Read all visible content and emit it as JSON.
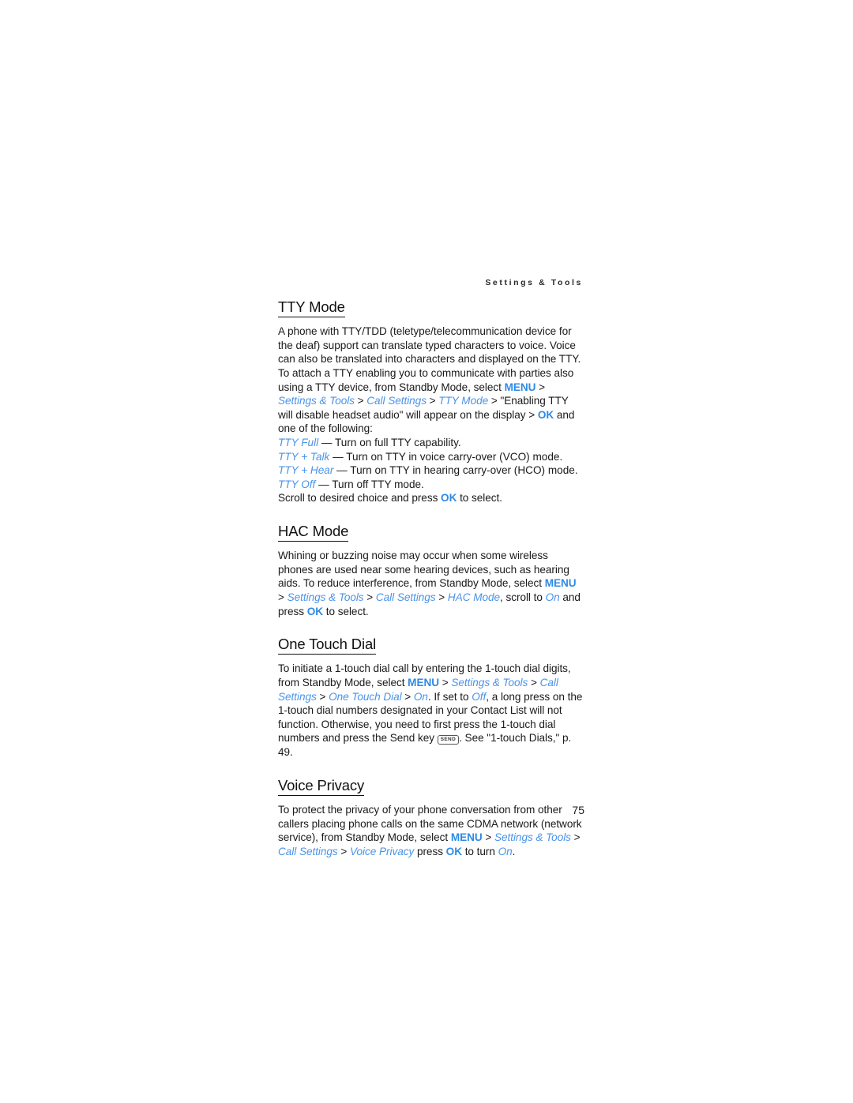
{
  "page": {
    "running_header": "Settings & Tools",
    "page_number": "75",
    "accent_blue": "#4a93e8",
    "accent_blue_bold": "#2e8ae6",
    "text_color": "#1a1a1a",
    "background": "#ffffff"
  },
  "sections": [
    {
      "id": "tty-mode",
      "heading": "TTY Mode",
      "paragraph_1": {
        "t1": "A phone with TTY/TDD (teletype/telecommunication device for the deaf) support can translate typed characters to voice. Voice can also be translated into characters and displayed on the TTY. To attach a TTY enabling you to communicate with parties also using a TTY device, from Standby Mode, select ",
        "menu": "MENU",
        "s1": " > ",
        "nav1": "Settings & Tools",
        "s2": " > ",
        "nav2": "Call Settings",
        "s3": " > ",
        "nav3": "TTY Mode",
        "s4": " > ",
        "t2": "\"Enabling TTY will disable headset audio\" will appear on the display > ",
        "ok": "OK",
        "t3": " and one of the following:"
      },
      "options": [
        {
          "term": "TTY Full",
          "desc": " — Turn on full TTY capability."
        },
        {
          "term": "TTY + Talk",
          "desc": " — Turn on TTY in voice carry-over (VCO) mode."
        },
        {
          "term": "TTY + Hear",
          "desc": " — Turn on TTY in hearing carry-over (HCO) mode."
        },
        {
          "term": "TTY Off",
          "desc": " — Turn off TTY mode."
        }
      ],
      "closing": {
        "t1": "Scroll to desired choice and press ",
        "ok": "OK",
        "t2": " to select."
      }
    },
    {
      "id": "hac-mode",
      "heading": "HAC Mode",
      "paragraph_1": {
        "t1": "Whining or buzzing noise may occur when some wireless phones are used near some hearing devices, such as hearing aids. To reduce interference, from Standby Mode, select ",
        "menu": "MENU",
        "s1": " > ",
        "nav1": "Settings & Tools",
        "s2": " > ",
        "nav2": "Call Settings",
        "s3": " > ",
        "nav3": "HAC Mode",
        "t2": ", scroll to ",
        "nav4": "On",
        "t3": " and press ",
        "ok": "OK",
        "t4": " to select."
      }
    },
    {
      "id": "one-touch-dial",
      "heading": "One Touch Dial",
      "paragraph_1": {
        "t1": "To initiate a 1-touch dial call by entering the 1-touch dial digits, from Standby Mode, select ",
        "menu": "MENU",
        "s1": " > ",
        "nav1": "Settings & Tools",
        "s2": " > ",
        "nav2": "Call Settings",
        "s3": " > ",
        "nav3": "One Touch Dial",
        "s4": " > ",
        "nav4": "On",
        "t2": ". If set to ",
        "nav5": "Off",
        "t3": ", a long press on the 1-touch dial numbers designated in your Contact List will not function. Otherwise, you need to first press the 1-touch dial numbers and press the Send key ",
        "send_key_label": "SEND",
        "t4": ". See \"1-touch Dials,\" p. 49."
      }
    },
    {
      "id": "voice-privacy",
      "heading": "Voice Privacy",
      "paragraph_1": {
        "t1": "To protect the privacy of your phone conversation from other callers placing phone calls on the same CDMA network (network service), from Standby Mode, select ",
        "menu": "MENU",
        "s1": " > ",
        "nav1": "Settings & Tools",
        "s2": " > ",
        "nav2": "Call Settings",
        "s3": " > ",
        "nav3": "Voice Privacy",
        "t2": " press ",
        "ok": "OK",
        "t3": " to turn ",
        "nav4": "On",
        "t4": "."
      }
    }
  ]
}
